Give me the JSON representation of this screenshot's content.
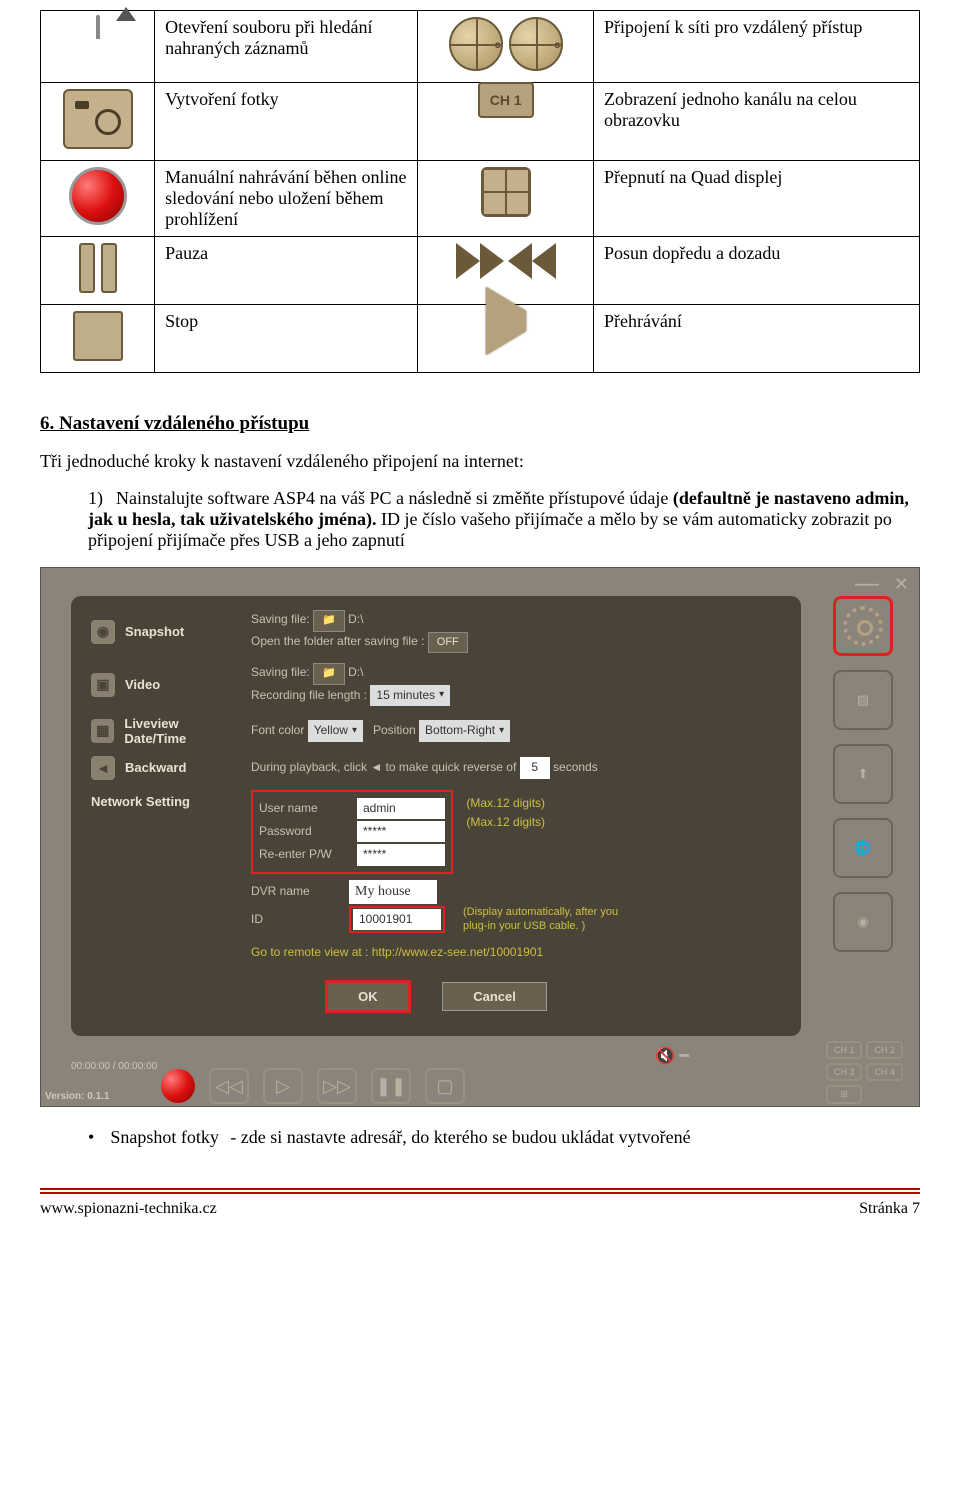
{
  "iconTable": {
    "rows": [
      {
        "left": "Otevření souboru při hledání nahraných záznamů",
        "right": "Připojení k síti pro vzdálený přístup",
        "leftIcon": "folder-up",
        "rightIcon": "globes",
        "globe1": "on",
        "globe2": "off"
      },
      {
        "left": "Vytvoření fotky",
        "right": "Zobrazení jednoho kanálu na celou obrazovku",
        "leftIcon": "camera",
        "rightIcon": "ch1",
        "ch1": "CH 1"
      },
      {
        "left": "Manuální nahrávání běhen online sledování nebo uložení během prohlížení",
        "right": "Přepnutí na Quad displej",
        "leftIcon": "record",
        "rightIcon": "grid"
      },
      {
        "left": "Pauza",
        "right": "Posun dopředu a dozadu",
        "leftIcon": "pause",
        "rightIcon": "ffrw"
      },
      {
        "left": "Stop",
        "right": "Přehrávání",
        "leftIcon": "stop",
        "rightIcon": "play"
      }
    ]
  },
  "section": {
    "num": "6.",
    "title": "Nastavení vzdáleného přístupu",
    "intro": "Tři jednoduché kroky k nastavení vzdáleného připojení na internet:",
    "li1_num": "1)",
    "li1_a": "Nainstalujte software ASP4 na váš PC a následně si změňte přístupové údaje ",
    "li1_b": "(defaultně je nastaveno admin, jak u hesla, tak uživatelského jména).",
    "li1_c": " ID je číslo vašeho přijímače a mělo by se vám automaticky zobrazit po připojení přijímače přes USB a jeho zapnutí"
  },
  "app": {
    "rows": {
      "snapshot": {
        "label": "Snapshot",
        "l1a": "Saving file:",
        "l1b": "D:\\",
        "l2": "Open the folder after saving file :",
        "l2v": "OFF"
      },
      "video": {
        "label": "Video",
        "l1a": "Saving file:",
        "l1b": "D:\\",
        "l2": "Recording file length :",
        "l2v": "15 minutes"
      },
      "liveview": {
        "label": "Liveview Date/Time",
        "l1": "Font color",
        "l1v": "Yellow",
        "l2": "Position",
        "l2v": "Bottom-Right"
      },
      "backward": {
        "label": "Backward",
        "l1a": "During playback, click",
        "l1b": "to make quick reverse of",
        "l1v": "5",
        "l1c": "seconds"
      },
      "network": {
        "label": "Network Setting",
        "user_l": "User name",
        "user_v": "admin",
        "max1": "(Max.12 digits)",
        "pass_l": "Password",
        "pass_v": "*****",
        "max2": "(Max.12 digits)",
        "re_l": "Re-enter P/W",
        "re_v": "*****",
        "dvr_l": "DVR name",
        "dvr_v": "My house",
        "id_l": "ID",
        "id_v": "10001901",
        "auto": "(Display automatically, after you plug-in your USB cable. )",
        "goto": "Go to remote view at :  http://www.ez-see.net/10001901"
      }
    },
    "buttons": {
      "ok": "OK",
      "cancel": "Cancel"
    },
    "timebar": "00:00:00 / 00:00:00",
    "version": "Version: 0.1.1",
    "ch": {
      "c1": "CH 1",
      "c2": "CH 2",
      "c3": "CH 3",
      "c4": "CH 4"
    }
  },
  "bullet": {
    "word": "Snapshot fotky",
    "desc": "- zde si nastavte adresář, do kterého se budou ukládat vytvořené"
  },
  "footer": {
    "left": "www.spionazni-technika.cz",
    "right": "Stránka 7"
  }
}
